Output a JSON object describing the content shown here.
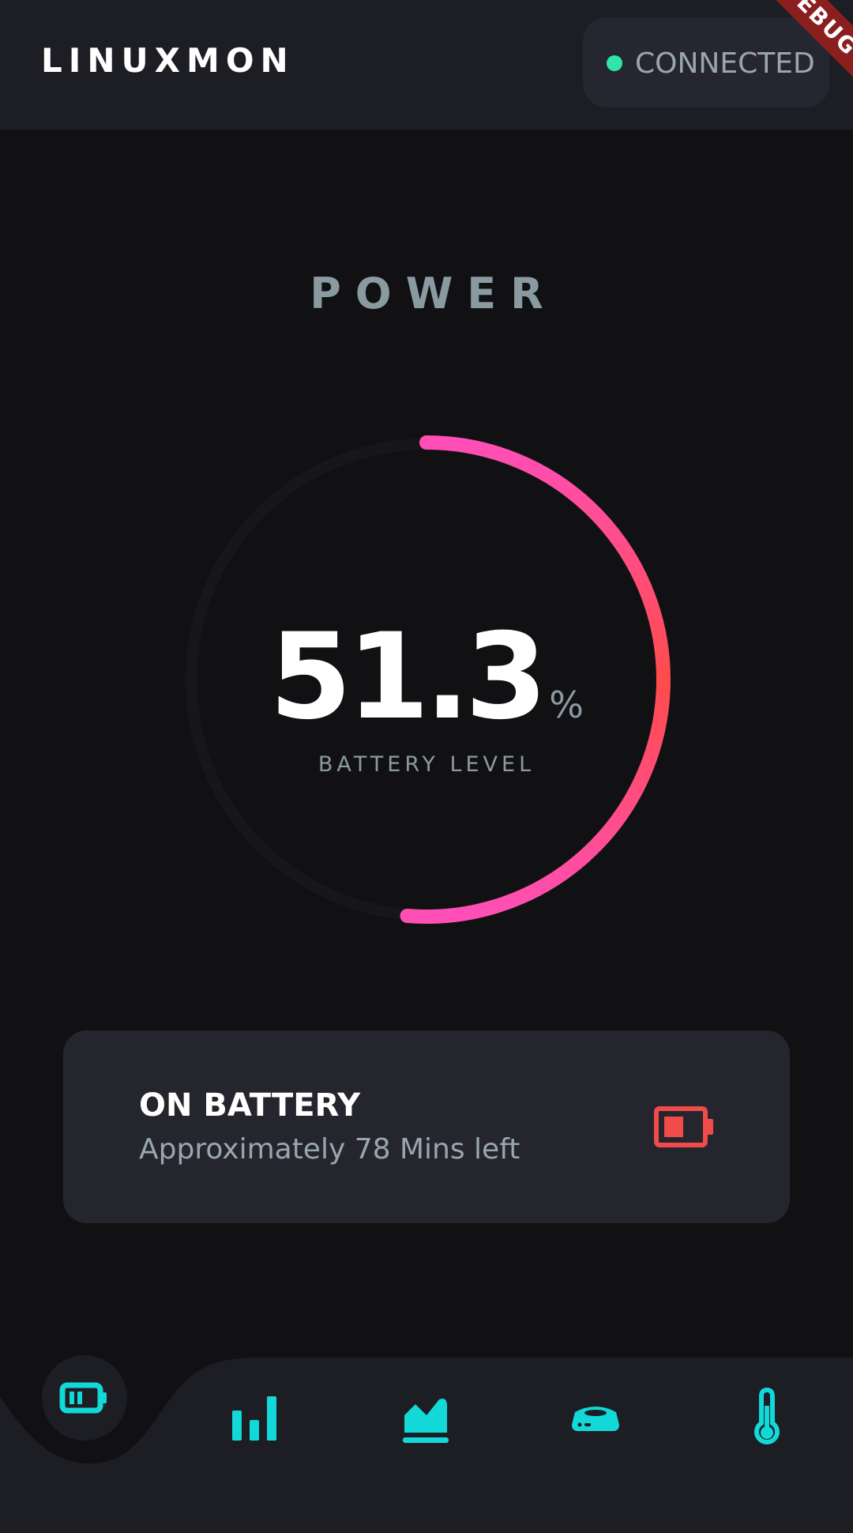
{
  "app": {
    "title": "LINUXMON",
    "connection_status": "CONNECTED",
    "debug_banner": "DEBUG"
  },
  "page": {
    "title": "POWER"
  },
  "gauge": {
    "value": "51.3",
    "unit": "%",
    "label": "BATTERY LEVEL",
    "level_fraction": 0.513
  },
  "card": {
    "title": "ON BATTERY",
    "subtitle": "Approximately 78 Mins left",
    "icon": "battery-low-icon"
  },
  "nav": {
    "items": [
      {
        "icon": "battery-icon",
        "active": true
      },
      {
        "icon": "bar-chart-icon",
        "active": false
      },
      {
        "icon": "area-chart-icon",
        "active": false
      },
      {
        "icon": "disk-drive-icon",
        "active": false
      },
      {
        "icon": "thermometer-icon",
        "active": false
      }
    ]
  },
  "colors": {
    "accent": "#12d8d8",
    "gauge_start": "#ff4fb7",
    "gauge_end": "#ff4b4b",
    "status_dot": "#2ee6a8",
    "battery_warning": "#f04a4a",
    "background": "#111114",
    "surface": "#25252e"
  }
}
